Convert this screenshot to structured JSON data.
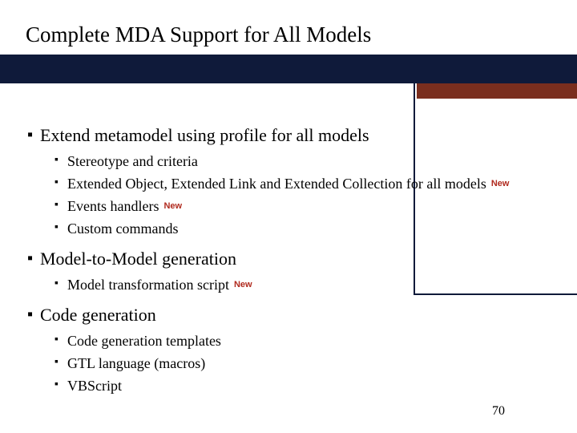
{
  "title": "Complete MDA Support for All Models",
  "newLabel": "New",
  "pageNumber": "70",
  "sections": {
    "s1": {
      "heading": "Extend metamodel using profile for all models",
      "items": {
        "i1": "Stereotype and criteria",
        "i2": "Extended Object, Extended Link and Extended Collection for all models",
        "i3": "Events handlers",
        "i4": "Custom commands"
      }
    },
    "s2": {
      "heading": "Model-to-Model generation",
      "items": {
        "i1": "Model transformation script"
      }
    },
    "s3": {
      "heading": "Code generation",
      "items": {
        "i1": "Code generation templates",
        "i2": "GTL language (macros)",
        "i3": "VBScript"
      }
    }
  }
}
